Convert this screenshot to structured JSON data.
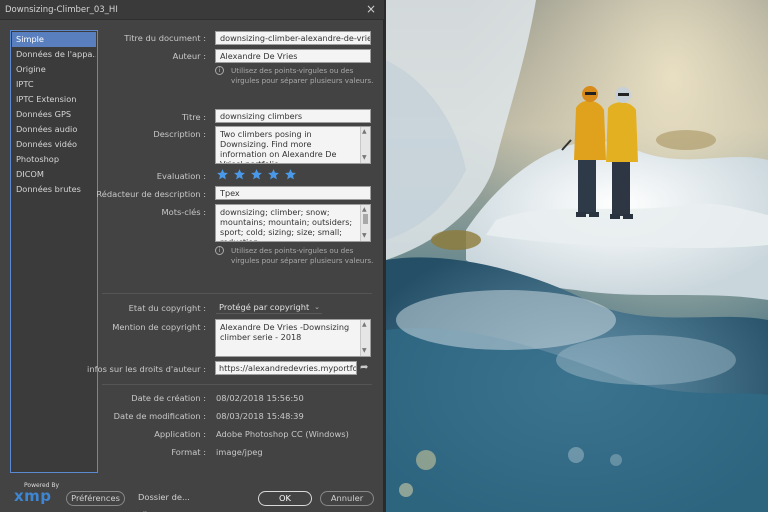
{
  "window": {
    "title": "Downsizing-Climber_03_HI",
    "close": "×"
  },
  "sidebar": {
    "items": [
      {
        "label": "Simple",
        "active": true
      },
      {
        "label": "Données de l'appa..."
      },
      {
        "label": "Origine"
      },
      {
        "label": "IPTC"
      },
      {
        "label": "IPTC Extension"
      },
      {
        "label": "Données GPS"
      },
      {
        "label": "Données audio"
      },
      {
        "label": "Données vidéo"
      },
      {
        "label": "Photoshop"
      },
      {
        "label": "DICOM"
      },
      {
        "label": "Données brutes"
      }
    ]
  },
  "fields": {
    "doc_title": {
      "label": "Titre du document :",
      "value": "downsizing-climber-alexandre-de-vries"
    },
    "author": {
      "label": "Auteur :",
      "value": "Alexandre De Vries"
    },
    "author_hint": "Utilisez des points-virgules ou des virgules pour séparer plusieurs valeurs.",
    "title": {
      "label": "Titre :",
      "value": "downsizing climbers"
    },
    "description": {
      "label": "Description :",
      "value": "Two climbers posing in Downsizing. Find more information on Alexandre De Vries' portfolio."
    },
    "rating": {
      "label": "Evaluation :",
      "stars": 5,
      "max": 5,
      "color": "#4a98e8"
    },
    "desc_writer": {
      "label": "Rédacteur de description :",
      "value": "Tpex"
    },
    "keywords": {
      "label": "Mots-clés :",
      "value": "downsizing; climber; snow; mountains; mountain; outsiders; sport; cold; sizing; size; small; reduction;"
    },
    "keywords_hint": "Utilisez des points-virgules ou des virgules pour séparer plusieurs valeurs.",
    "copyright_status": {
      "label": "Etat du copyright :",
      "value": "Protégé par copyright"
    },
    "copyright_notice": {
      "label": "Mention de copyright :",
      "value": "Alexandre De Vries -Downsizing climber serie - 2018"
    },
    "copyright_info": {
      "label": "infos sur les droits d'auteur :",
      "value": "https://alexandredevries.myportfolio."
    },
    "created": {
      "label": "Date de création :",
      "value": "08/02/2018 15:56:50"
    },
    "modified": {
      "label": "Date de modification :",
      "value": "08/03/2018 15:48:39"
    },
    "application": {
      "label": "Application :",
      "value": "Adobe Photoshop CC (Windows)"
    },
    "format": {
      "label": "Format :",
      "value": "image/jpeg"
    }
  },
  "footer": {
    "powered_by": "Powered By",
    "xmp": "xmp",
    "preferences": "Préférences",
    "folder": "Dossier de...",
    "ok": "OK",
    "cancel": "Annuler"
  },
  "icons": {
    "info": "info-icon",
    "share": "share-arrow-icon",
    "chevron": "chevron-down-icon",
    "star": "star-icon"
  }
}
